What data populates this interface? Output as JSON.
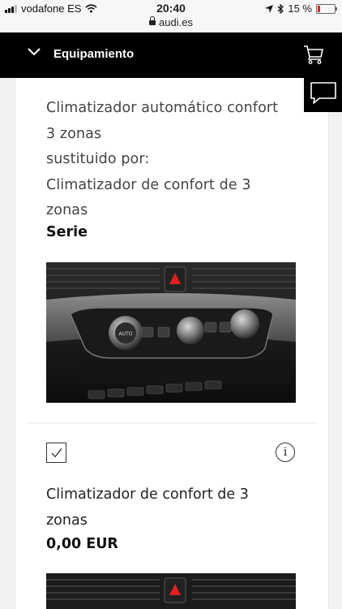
{
  "status_bar": {
    "carrier": "vodafone ES",
    "time": "20:40",
    "url": "audi.es",
    "battery": "15 %"
  },
  "header": {
    "title": "Equipamiento",
    "icons": [
      "chevron-down-icon",
      "cart-icon",
      "chat-icon"
    ]
  },
  "item": {
    "description_lines": [
      "Climatizador automático confort",
      "3 zonas",
      "sustituido por:",
      "Climatizador de confort de 3",
      "zonas"
    ],
    "status": "Serie"
  },
  "option": {
    "name_lines": [
      "Climatizador de confort de 3",
      "zonas"
    ],
    "price": "0,00 EUR",
    "checked": true,
    "info_symbol": "i"
  },
  "colors": {
    "header_bg": "#000000",
    "battery_low": "#e02020"
  }
}
